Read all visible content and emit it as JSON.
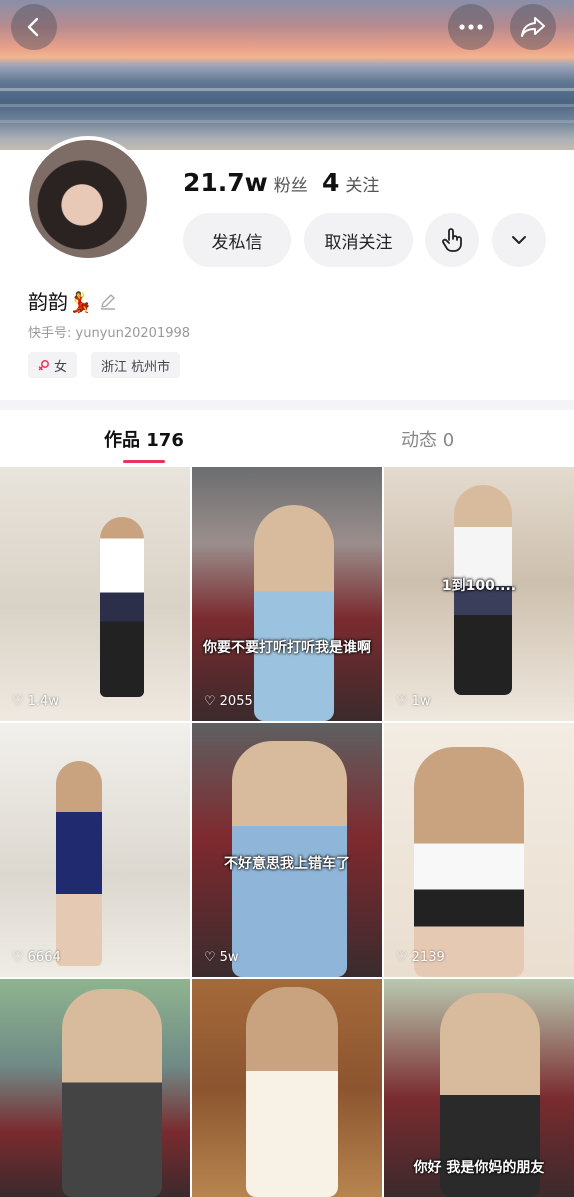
{
  "header": {
    "back_icon": "chevron-left-icon",
    "more_icon": "more-dots-icon",
    "share_icon": "share-arrow-icon"
  },
  "profile": {
    "followers_count": "21.7w",
    "followers_label": "粉丝",
    "following_count": "4",
    "following_label": "关注",
    "message_button": "发私信",
    "unfollow_button": "取消关注",
    "name": "韵韵💃",
    "kuaishou_id": "快手号: yunyun20201998",
    "gender_tag": "女",
    "location_tag": "浙江 杭州市"
  },
  "tabs": [
    {
      "label": "作品 176"
    },
    {
      "label": "动态 0"
    }
  ],
  "works": [
    {
      "likes": "1.4w",
      "caption": ""
    },
    {
      "likes": "2055",
      "caption": "你要不要打听打听我是谁啊"
    },
    {
      "likes": "1w",
      "caption": "1到100...."
    },
    {
      "likes": "6664",
      "caption": ""
    },
    {
      "likes": "5w",
      "caption": "不好意思我上错车了"
    },
    {
      "likes": "2139",
      "caption": ""
    },
    {
      "likes": "",
      "caption": ""
    },
    {
      "likes": "",
      "caption": ""
    },
    {
      "likes": "",
      "caption": "你好 我是你妈的朋友"
    }
  ],
  "colors": {
    "accent": "#e8335a",
    "pill_bg": "#f2f2f4"
  }
}
